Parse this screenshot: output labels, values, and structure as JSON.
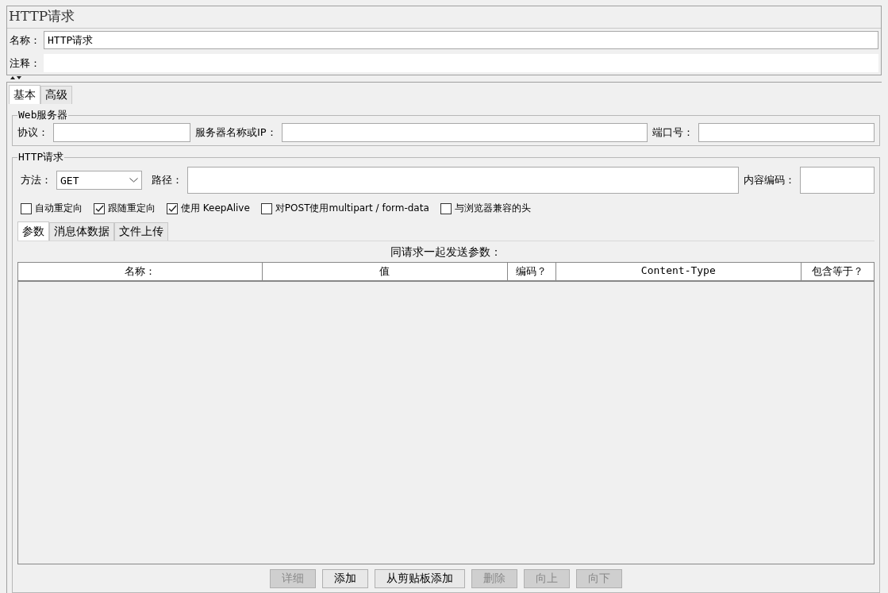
{
  "title": "HTTP请求",
  "name_field": {
    "label": "名称：",
    "value": "HTTP请求"
  },
  "comment_field": {
    "label": "注释："
  },
  "tabs": [
    {
      "label": "基本",
      "selected": true
    },
    {
      "label": "高级",
      "selected": false
    }
  ],
  "web_server": {
    "legend": "Web服务器",
    "protocol_label": "协议：",
    "server_label": "服务器名称或IP：",
    "port_label": "端口号："
  },
  "http_request": {
    "legend": "HTTP请求",
    "method_label": "方法：",
    "method": "GET",
    "path_label": "路径：",
    "encoding_label": "内容编码：",
    "options": [
      {
        "label": "自动重定向",
        "checked": false
      },
      {
        "label": "跟随重定向",
        "checked": true
      },
      {
        "label": "使用 KeepAlive",
        "checked": true
      },
      {
        "label": "对POST使用multipart / form-data",
        "checked": false
      },
      {
        "label": "与浏览器兼容的头",
        "checked": false
      }
    ],
    "tabs": [
      {
        "label": "参数",
        "selected": true
      },
      {
        "label": "消息体数据",
        "selected": false
      },
      {
        "label": "文件上传",
        "selected": false
      }
    ],
    "params": {
      "caption": "同请求一起发送参数：",
      "columns": [
        "名称：",
        "值",
        "编码？",
        "Content-Type",
        "包含等于？"
      ]
    },
    "buttons": [
      {
        "label": "详细",
        "disabled": true
      },
      {
        "label": "添加",
        "disabled": false
      },
      {
        "label": "从剪贴板添加",
        "disabled": false
      },
      {
        "label": "删除",
        "disabled": true
      },
      {
        "label": "向上",
        "disabled": true
      },
      {
        "label": "向下",
        "disabled": true
      }
    ]
  }
}
